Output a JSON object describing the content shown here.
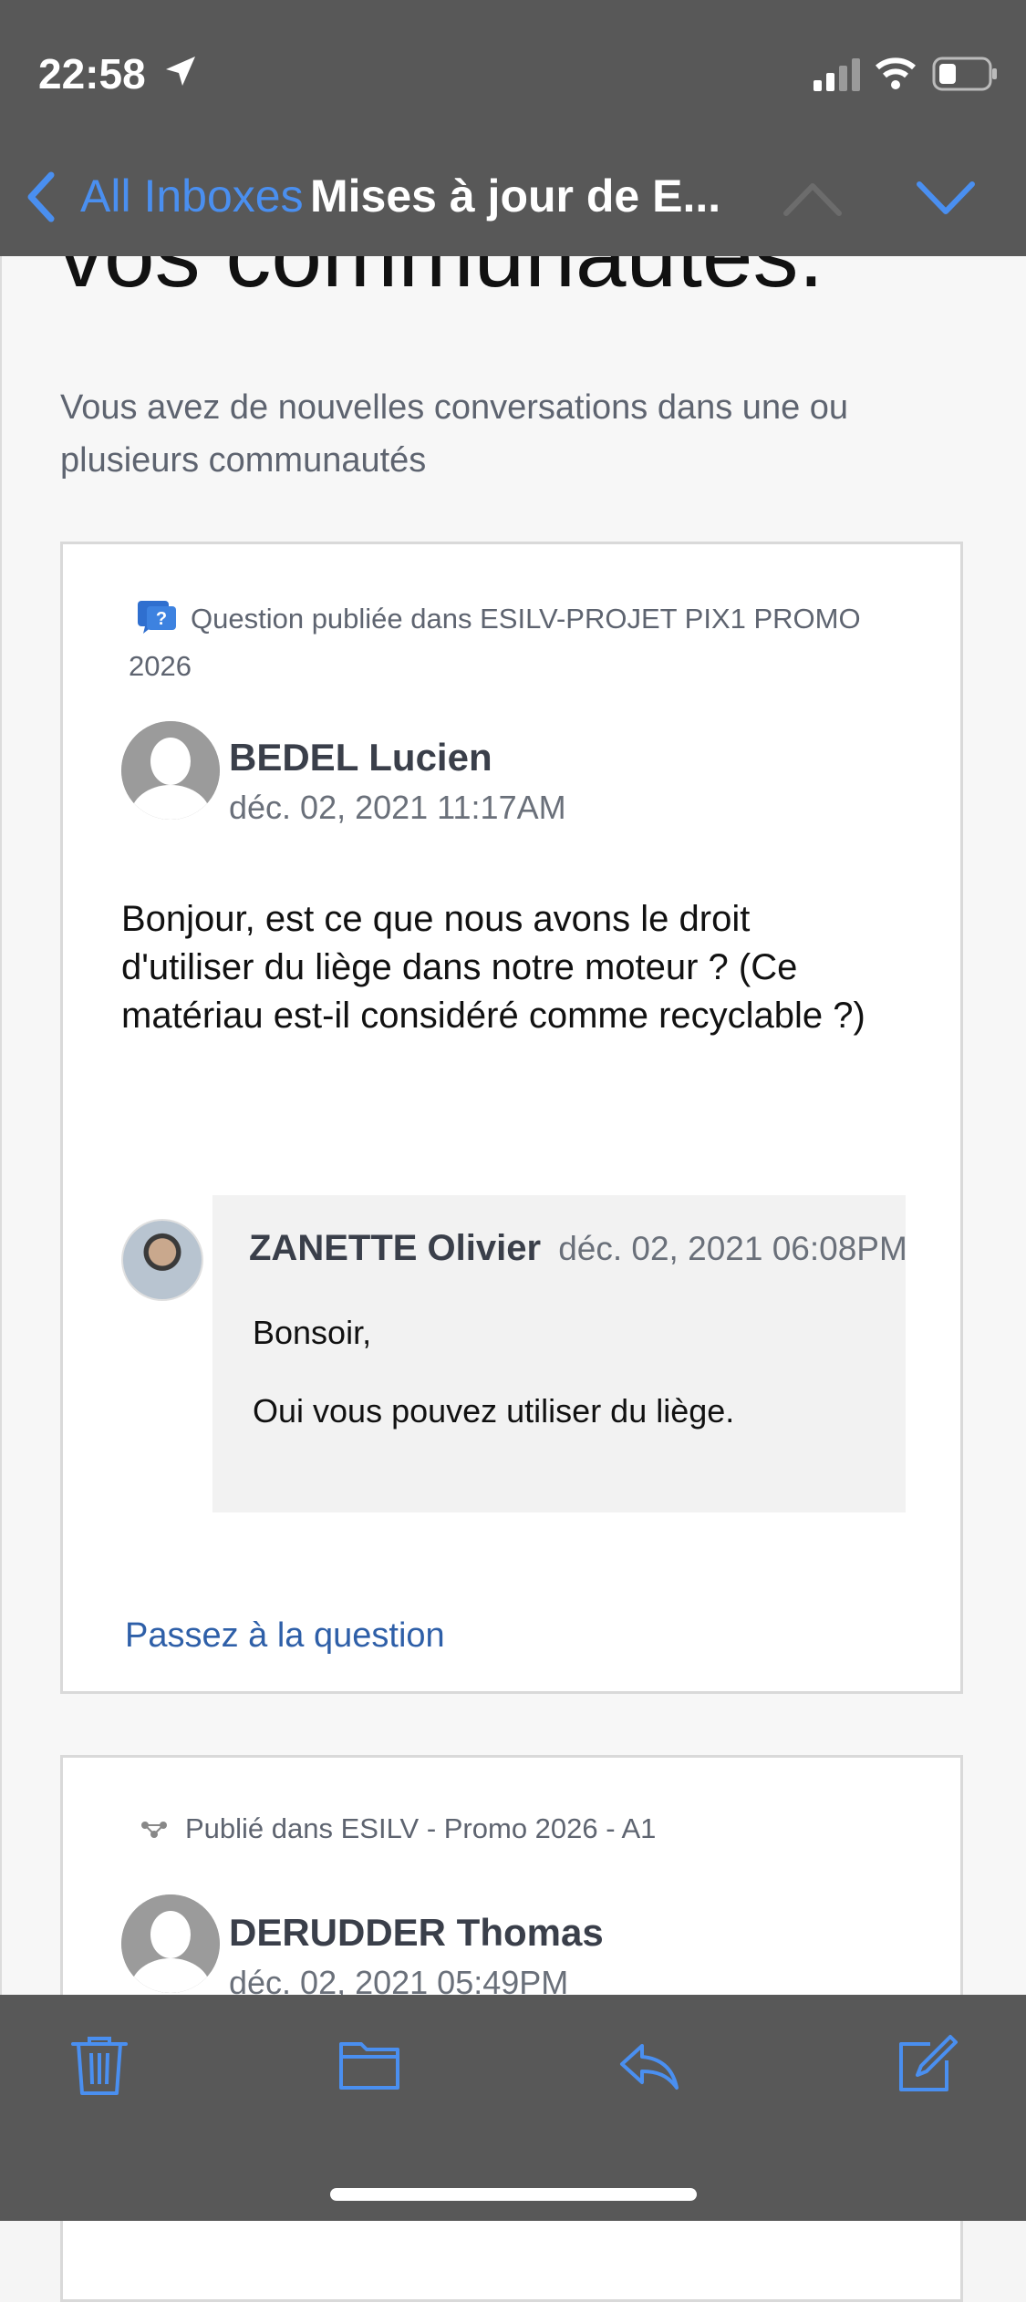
{
  "status_bar": {
    "time": "22:58"
  },
  "nav": {
    "back_label": "All Inboxes",
    "title": "Mises à jour de E..."
  },
  "email": {
    "hero_heading": "vos communautés.",
    "intro": "Vous avez de nouvelles conversations dans une ou plusieurs communautés",
    "card1": {
      "posted_in": "Question publiée dans ESILV-PROJET PIX1 PROMO 2026",
      "author": "BEDEL Lucien",
      "date": "déc. 02, 2021 11:17AM",
      "body": "Bonjour, est ce que nous avons le droit d'utiliser du liège dans notre moteur ? (Ce matériau est-il considéré comme recyclable ?)",
      "reply": {
        "author": "ZANETTE Olivier",
        "date": "déc. 02, 2021 06:08PM",
        "paragraph1": "Bonsoir,",
        "paragraph2": "Oui vous pouvez utiliser du liège."
      },
      "link_label": "Passez à la question"
    },
    "card2": {
      "posted_in": "Publié dans ESILV - Promo 2026 - A1",
      "author": "DERUDDER Thomas",
      "date": "déc. 02, 2021 05:49PM"
    }
  },
  "colors": {
    "bar_bg": "#585858",
    "accent": "#4a8ff0",
    "link": "#2e5fa8"
  },
  "toolbar_icons": [
    "trash-icon",
    "folder-icon",
    "reply-icon",
    "compose-icon"
  ]
}
